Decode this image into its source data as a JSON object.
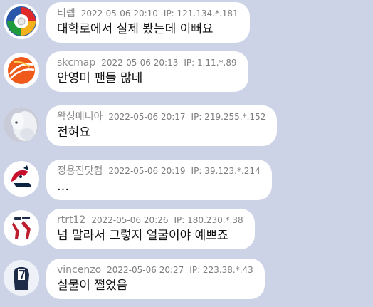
{
  "comments": [
    {
      "nickname": "티렙",
      "timestamp": "2022-05-06 20:10",
      "ip": "IP: 121.134.*.181",
      "text": "대학로에서 실제 봤는데 이뻐요",
      "avatar_icon": "baseball-team-emblem-icon"
    },
    {
      "nickname": "skcmap",
      "timestamp": "2022-05-06 20:13",
      "ip": "IP: 1.11.*.89",
      "text": "안영미 팬들 많네",
      "avatar_icon": "orange-ball-logo-icon"
    },
    {
      "nickname": "왁싱매니아",
      "timestamp": "2022-05-06 20:17",
      "ip": "IP: 219.255.*.152",
      "text": "전혀요",
      "avatar_icon": "white-puppy-photo-icon"
    },
    {
      "nickname": "정용진닷컴",
      "timestamp": "2022-05-06 20:19",
      "ip": "IP: 39.123.*.214",
      "text": "…",
      "avatar_icon": "indians-logo-icon"
    },
    {
      "nickname": "rtrt12",
      "timestamp": "2022-05-06 20:26",
      "ip": "IP: 180.230.*.38",
      "text": "넘 말라서 그렇지 얼굴이야 예쁘죠",
      "avatar_icon": "red-sox-logo-icon"
    },
    {
      "nickname": "vincenzo",
      "timestamp": "2022-05-06 20:27",
      "ip": "IP: 223.38.*.43",
      "text": "실물이 쩔었음",
      "avatar_icon": "jersey-number-7-icon"
    }
  ],
  "colors": {
    "background": "#ccd3e6",
    "bubble": "#ffffff",
    "meta_text": "#7d7d7d",
    "body_text": "#111111"
  }
}
